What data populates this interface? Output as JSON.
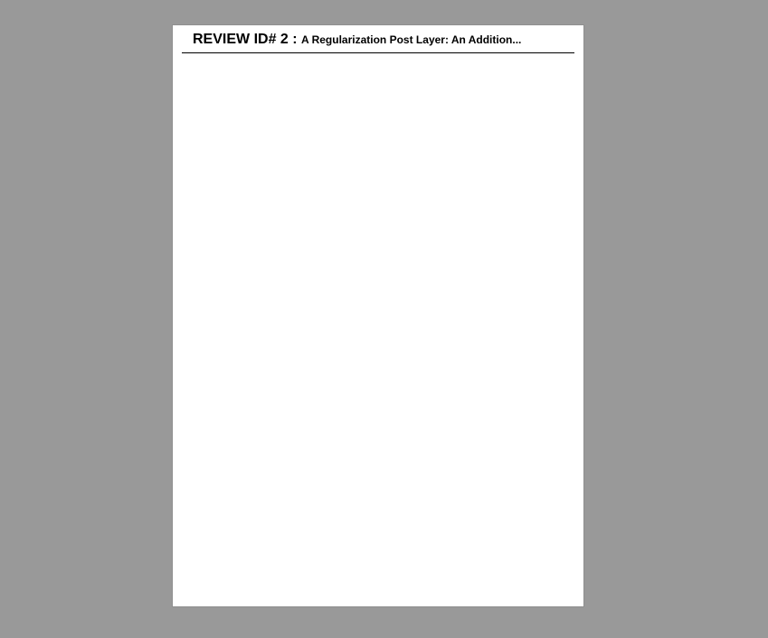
{
  "document": {
    "header": {
      "review_label": "REVIEW ID# 2 :",
      "title": "A Regularization Post Layer: An Addition..."
    }
  },
  "colors": {
    "viewer_background": "#999999",
    "page_background": "#ffffff",
    "text": "#000000"
  }
}
